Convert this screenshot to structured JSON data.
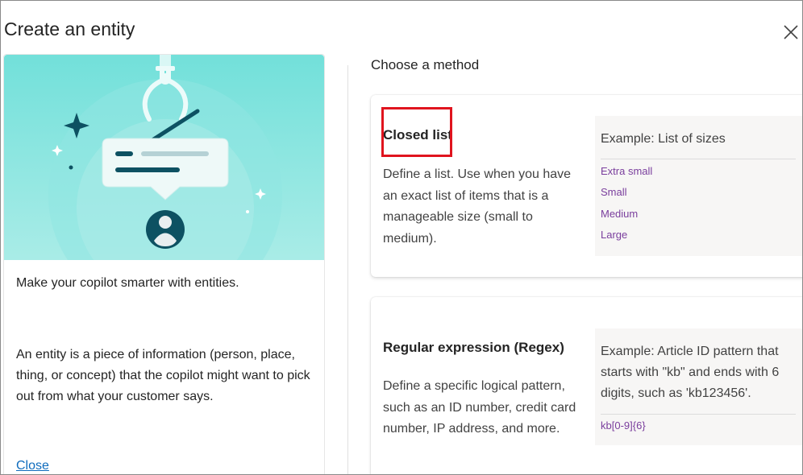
{
  "dialog": {
    "title": "Create an entity",
    "close_icon": "close-icon"
  },
  "left": {
    "intro": "Make your copilot smarter with entities.",
    "description": "An entity is a piece of information (person, place, thing, or concept) that the copilot might want to pick out from what your customer says.",
    "close_link": "Close"
  },
  "main": {
    "heading": "Choose a method",
    "methods": [
      {
        "title": "Closed list",
        "description": "Define a list. Use when you have an exact list of items that is a manageable size (small to medium).",
        "example_title": "Example: List of sizes",
        "example_items": [
          "Extra small",
          "Small",
          "Medium",
          "Large"
        ]
      },
      {
        "title": "Regular expression (Regex)",
        "description": "Define a specific logical pattern, such as an ID number, credit card number, IP address, and more.",
        "example_title": "Example: Article ID pattern that starts with \"kb\" and ends with 6 digits, such as 'kb123456'.",
        "example_items": [
          "kb[0-9]{6}"
        ]
      }
    ]
  },
  "colors": {
    "hero_bg": "#7ee4df",
    "accent_dark": "#0d5162",
    "link": "#0f6cbd",
    "example_item": "#7a3e9d",
    "highlight": "#e0141e"
  }
}
